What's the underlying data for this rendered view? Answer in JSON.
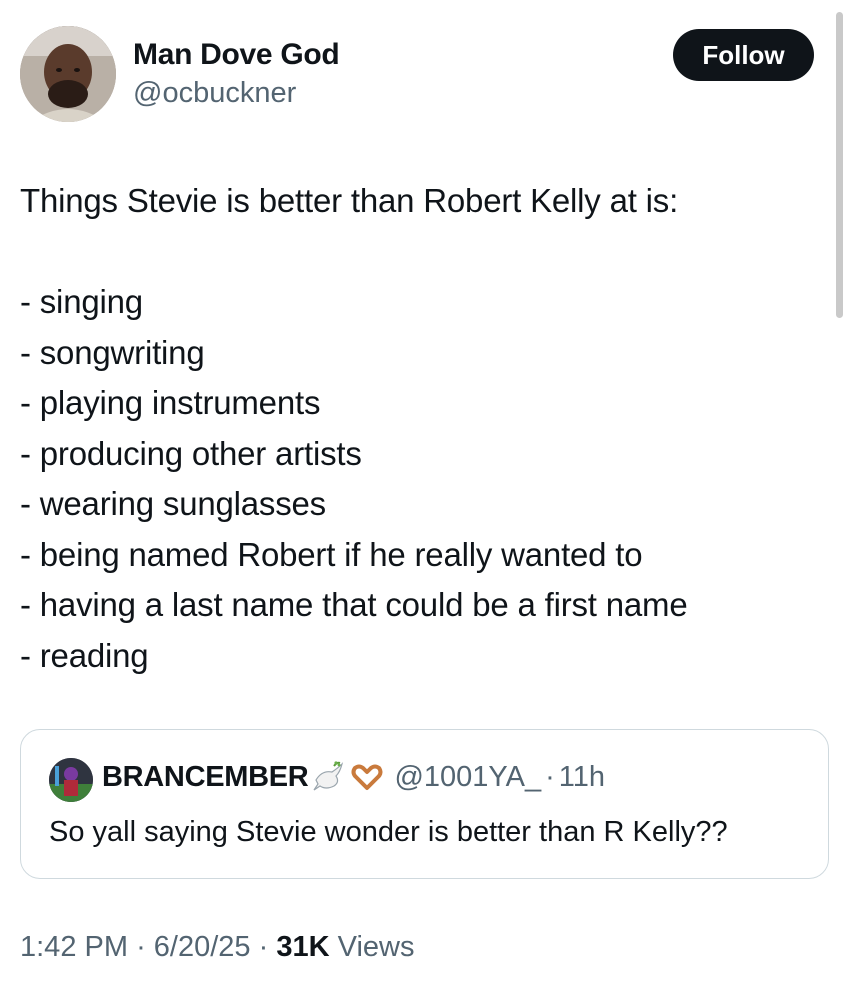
{
  "author": {
    "display_name": "Man Dove God",
    "handle": "@ocbuckner"
  },
  "follow_label": "Follow",
  "tweet": {
    "intro": "Things Stevie is better than Robert Kelly at is:",
    "items": [
      "- singing",
      "- songwriting",
      "- playing instruments",
      "- producing other artists",
      "- wearing sunglasses",
      "- being named Robert if he really wanted to",
      "- having a last name that could be a first name",
      "- reading"
    ]
  },
  "quote": {
    "display_name": "BRANCEMBER",
    "emojis": [
      "dove-emoji",
      "heart-hands-emoji"
    ],
    "handle": "@1001YA_",
    "separator": "·",
    "time": "11h",
    "text": "So yall saying Stevie wonder is better than R Kelly??"
  },
  "meta": {
    "time": "1:42 PM",
    "date": "6/20/25",
    "separator": "·",
    "views_count": "31K",
    "views_label": "Views"
  },
  "colors": {
    "text": "#0f1419",
    "secondary": "#536471",
    "border": "#cfd9de",
    "button_bg": "#0f1419"
  }
}
